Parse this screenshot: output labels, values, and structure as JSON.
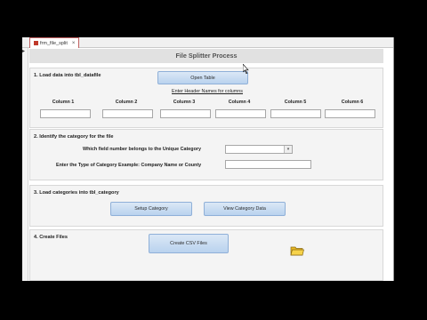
{
  "tab": {
    "label": "frm_file_split",
    "close_glyph": "×"
  },
  "record_selector": {
    "glyph": "▸"
  },
  "form": {
    "title": "File Splitter Process"
  },
  "section1": {
    "title": "1. Load data into tbl_datafile",
    "open_table_label": "Open Table",
    "header_prompt": "Enter Header Names for columns",
    "columns": [
      {
        "label": "Column 1",
        "value": ""
      },
      {
        "label": "Column 2",
        "value": ""
      },
      {
        "label": "Column 3",
        "value": ""
      },
      {
        "label": "Column 4",
        "value": ""
      },
      {
        "label": "Column 5",
        "value": ""
      },
      {
        "label": "Column 6",
        "value": ""
      }
    ]
  },
  "section2": {
    "title": "2. Identify the category for the file",
    "field_number_label": "Which field number belongs to the Unique Category",
    "field_number_value": "",
    "category_type_label": "Enter the Type of Category Example: Company Name or County",
    "category_type_value": ""
  },
  "section3": {
    "title": "3. Load categories into tbl_category",
    "setup_label": "Setup Category",
    "view_label": "View  Category Data"
  },
  "section4": {
    "title": "4. Create Files",
    "create_label": "Create CSV Files"
  },
  "icons": {
    "folder": "folder-icon",
    "cursor": "mouse-cursor-icon"
  },
  "colors": {
    "button_top": "#dbe8f6",
    "button_bottom": "#b9d2ee",
    "section_bg": "#f4f4f4",
    "title_bar": "#e1e1e1"
  }
}
